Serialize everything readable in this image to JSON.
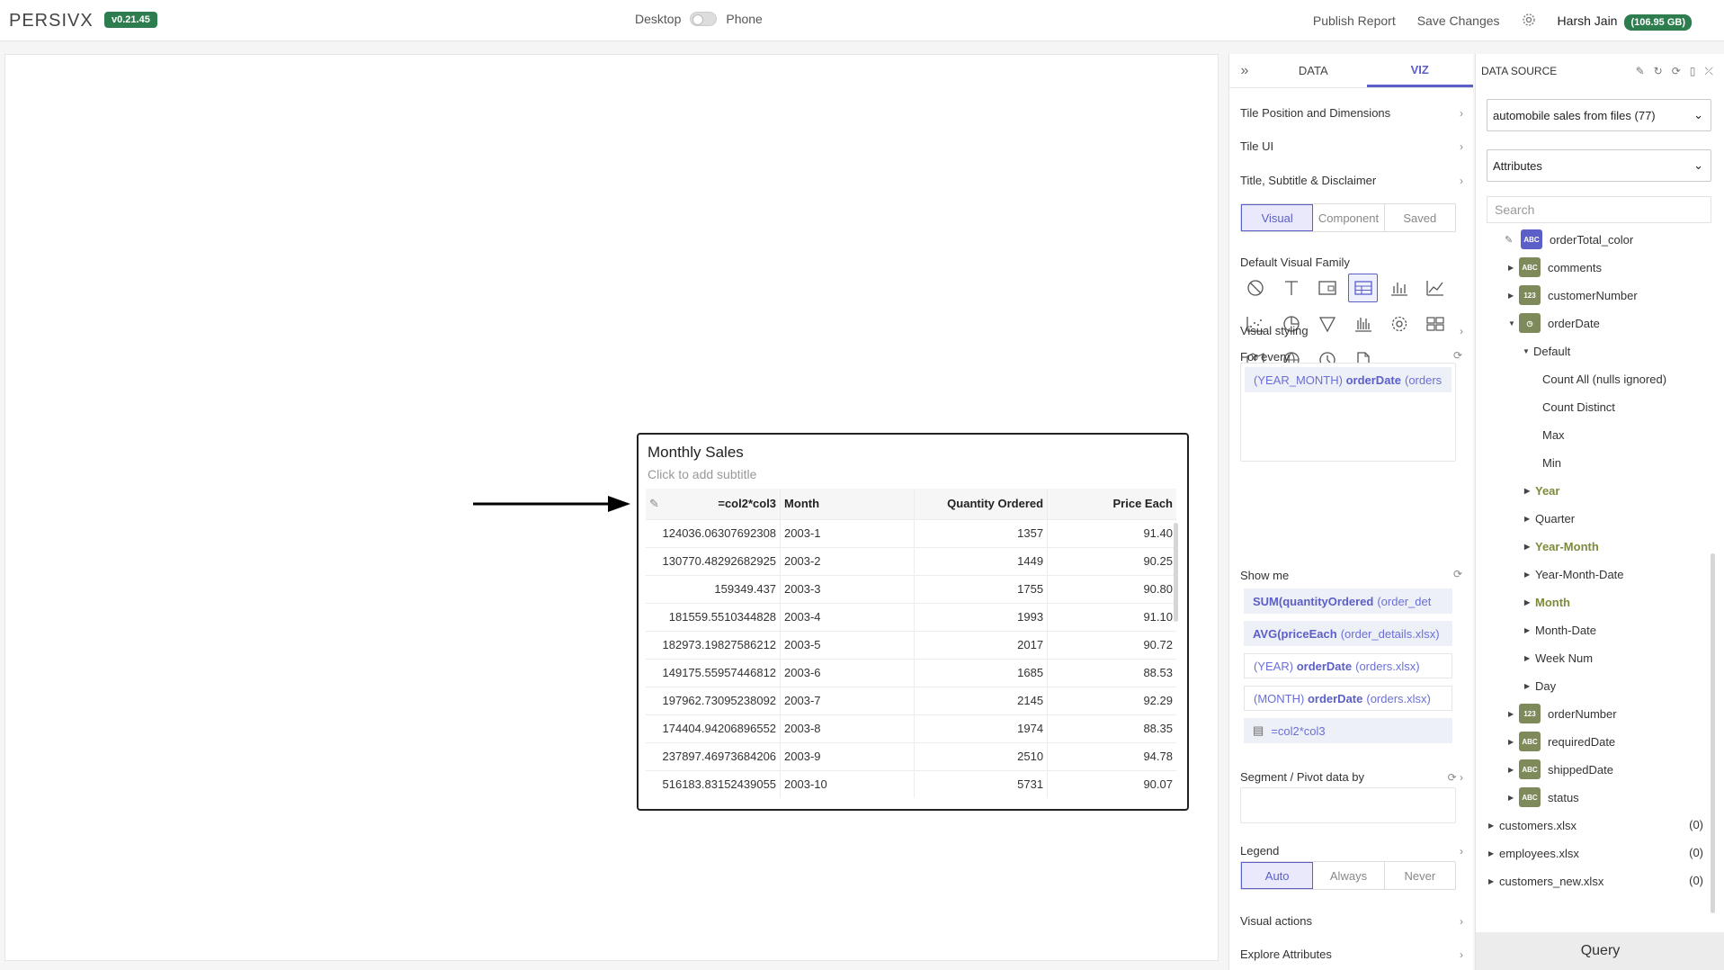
{
  "header": {
    "logo": "PERSIVX",
    "version": "v0.21.45",
    "desktop_label": "Desktop",
    "phone_label": "Phone",
    "publish_label": "Publish Report",
    "save_label": "Save Changes",
    "user_name": "Harsh Jain",
    "storage": "(106.95 GB)"
  },
  "tile": {
    "title": "Monthly Sales",
    "subtitle": "Click to add subtitle",
    "columns": [
      "=col2*col3",
      "Month",
      "Quantity Ordered",
      "Price Each"
    ],
    "rows": [
      [
        "124036.06307692308",
        "2003-1",
        "1357",
        "91.40"
      ],
      [
        "130770.48292682925",
        "2003-2",
        "1449",
        "90.25"
      ],
      [
        "159349.437",
        "2003-3",
        "1755",
        "90.80"
      ],
      [
        "181559.5510344828",
        "2003-4",
        "1993",
        "91.10"
      ],
      [
        "182973.19827586212",
        "2003-5",
        "2017",
        "90.72"
      ],
      [
        "149175.55957446812",
        "2003-6",
        "1685",
        "88.53"
      ],
      [
        "197962.73095238092",
        "2003-7",
        "2145",
        "92.29"
      ],
      [
        "174404.94206896552",
        "2003-8",
        "1974",
        "88.35"
      ],
      [
        "237897.46973684206",
        "2003-9",
        "2510",
        "94.78"
      ],
      [
        "516183.83152439055",
        "2003-10",
        "5731",
        "90.07"
      ]
    ]
  },
  "viz_panel": {
    "tabs": [
      "DATA",
      "VIZ"
    ],
    "tile_position": "Tile Position and Dimensions",
    "tile_ui": "Tile UI",
    "title_subtitle": "Title, Subtitle & Disclaimer",
    "mode_tabs": [
      "Visual",
      "Component",
      "Saved"
    ],
    "default_visual_family": "Default Visual Family",
    "visual_styling": "Visual styling",
    "for_every": "For every",
    "for_every_item": {
      "fn": "(YEAR_MONTH)",
      "field": "orderDate",
      "src": "(orders"
    },
    "show_me": "Show me",
    "show_me_items": [
      {
        "fn": "SUM(",
        "field": "quantityOrdered",
        "src": "(order_det"
      },
      {
        "fn": "AVG(",
        "field": "priceEach",
        "src": "(order_details.xlsx)"
      },
      {
        "fn": "(YEAR)",
        "field": "orderDate",
        "src": "(orders.xlsx)"
      },
      {
        "fn": "(MONTH)",
        "field": "orderDate",
        "src": "(orders.xlsx)"
      }
    ],
    "calc_item": "=col2*col3",
    "segment": "Segment / Pivot data by",
    "legend": "Legend",
    "legend_tabs": [
      "Auto",
      "Always",
      "Never"
    ],
    "visual_actions": "Visual actions",
    "explore_attributes": "Explore Attributes"
  },
  "data_source": {
    "title": "DATA SOURCE",
    "source_select": "automobile sales from files (77)",
    "attr_select": "Attributes",
    "search_placeholder": "Search",
    "badges": {
      "abc": "ABC",
      "num": "123"
    },
    "tree": {
      "orderTotal_color": "orderTotal_color",
      "comments": "comments",
      "customerNumber": "customerNumber",
      "orderDate": "orderDate",
      "default": "Default",
      "count_all": "Count All (nulls ignored)",
      "count_distinct": "Count Distinct",
      "max": "Max",
      "min": "Min",
      "year": "Year",
      "quarter": "Quarter",
      "year_month": "Year-Month",
      "year_month_date": "Year-Month-Date",
      "month": "Month",
      "month_date": "Month-Date",
      "week_num": "Week Num",
      "day": "Day",
      "orderNumber": "orderNumber",
      "requiredDate": "requiredDate",
      "shippedDate": "shippedDate",
      "status": "status"
    },
    "files": [
      {
        "name": "customers.xlsx",
        "count": "(0)"
      },
      {
        "name": "employees.xlsx",
        "count": "(0)"
      },
      {
        "name": "customers_new.xlsx",
        "count": "(0)"
      }
    ],
    "query_label": "Query"
  }
}
